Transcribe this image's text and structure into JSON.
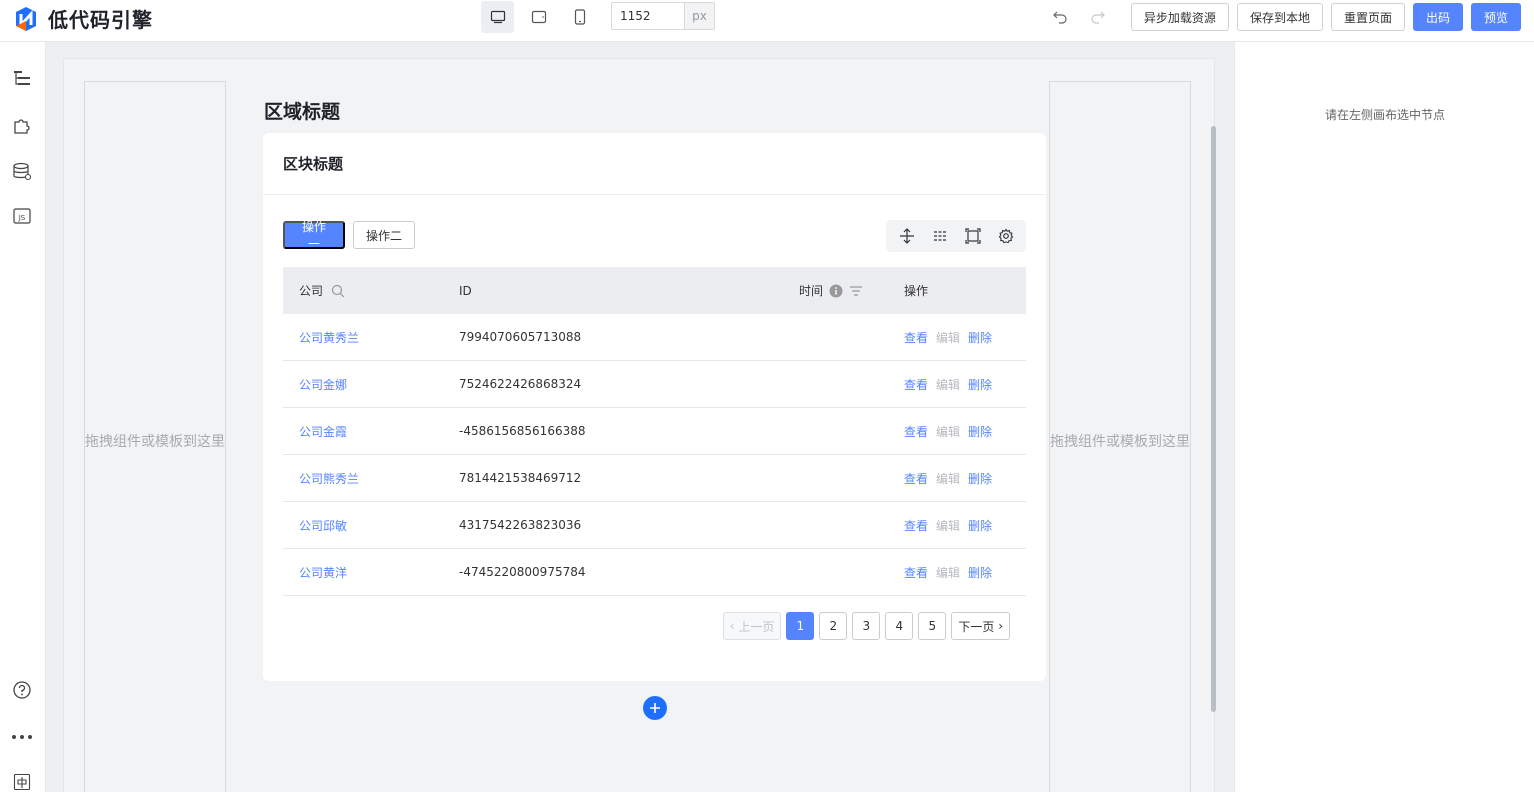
{
  "app": {
    "logo_text": "低代码引擎"
  },
  "topbar": {
    "width_value": "1152",
    "width_unit": "px",
    "buttons": {
      "async_load": "异步加载资源",
      "save_local": "保存到本地",
      "reset_page": "重置页面",
      "export_code": "出码",
      "preview": "预览"
    }
  },
  "canvas": {
    "drop_hint": "拖拽组件或模板到这里",
    "region_title": "区域标题",
    "block_title": "区块标题",
    "actions": {
      "op1": "操作一",
      "op2": "操作二"
    },
    "table": {
      "headers": {
        "company": "公司",
        "id": "ID",
        "time": "时间",
        "ops": "操作"
      },
      "row_ops": {
        "view": "查看",
        "edit": "编辑",
        "delete": "删除"
      },
      "rows": [
        {
          "company": "公司黄秀兰",
          "id": "7994070605713088"
        },
        {
          "company": "公司金娜",
          "id": "7524622426868324"
        },
        {
          "company": "公司金霞",
          "id": "-4586156856166388"
        },
        {
          "company": "公司熊秀兰",
          "id": "7814421538469712"
        },
        {
          "company": "公司邱敏",
          "id": "4317542263823036"
        },
        {
          "company": "公司黄洋",
          "id": "-4745220800975784"
        }
      ]
    },
    "pagination": {
      "prev": "上一页",
      "next": "下一页",
      "pages": [
        "1",
        "2",
        "3",
        "4",
        "5"
      ],
      "current": "1"
    }
  },
  "right_panel": {
    "hint": "请在左侧画布选中节点"
  },
  "colors": {
    "primary": "#5584ff",
    "add_button": "#1f6fff"
  }
}
